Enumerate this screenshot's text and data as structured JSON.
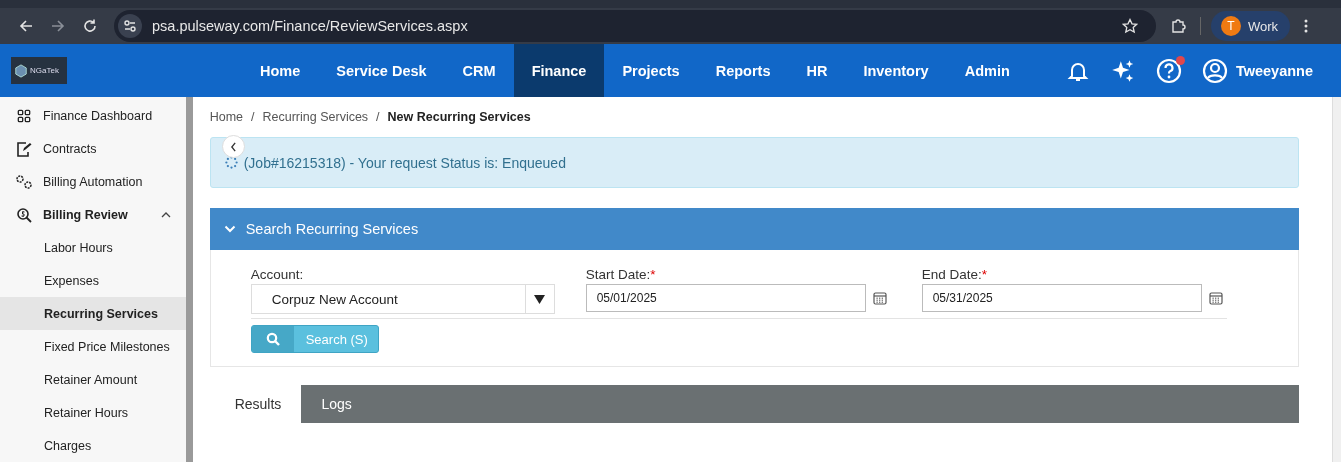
{
  "browser": {
    "url": "psa.pulseway.com/Finance/ReviewServices.aspx",
    "profile_initial": "T",
    "profile_name": "Work"
  },
  "logo": {
    "text": "NGaTek"
  },
  "nav": [
    {
      "label": "Home",
      "selected": false
    },
    {
      "label": "Service Desk",
      "selected": false
    },
    {
      "label": "CRM",
      "selected": false
    },
    {
      "label": "Finance",
      "selected": true
    },
    {
      "label": "Projects",
      "selected": false
    },
    {
      "label": "Reports",
      "selected": false
    },
    {
      "label": "HR",
      "selected": false
    },
    {
      "label": "Inventory",
      "selected": false
    },
    {
      "label": "Admin",
      "selected": false
    }
  ],
  "help_notification": true,
  "user": {
    "name": "Tweeyanne"
  },
  "sidebar": {
    "items": [
      {
        "label": "Finance Dashboard",
        "selected": false
      },
      {
        "label": "Contracts",
        "selected": false
      },
      {
        "label": "Billing Automation",
        "selected": false
      },
      {
        "label": "Billing Review",
        "expanded": true,
        "selected": false,
        "children": [
          {
            "label": "Labor Hours",
            "selected": false
          },
          {
            "label": "Expenses",
            "selected": false
          },
          {
            "label": "Recurring Services",
            "selected": true
          },
          {
            "label": "Fixed Price Milestones",
            "selected": false
          },
          {
            "label": "Retainer Amount",
            "selected": false
          },
          {
            "label": "Retainer Hours",
            "selected": false
          },
          {
            "label": "Charges",
            "selected": false
          }
        ]
      }
    ]
  },
  "breadcrumb": [
    {
      "label": "Home",
      "current": false
    },
    {
      "label": "Recurring Services",
      "current": false
    },
    {
      "label": "New Recurring Services",
      "current": true
    }
  ],
  "breadcrumb_separator": "/",
  "alert": {
    "text": "(Job#16215318) - Your request Status is: Enqueued"
  },
  "panel": {
    "title": "Search Recurring Services",
    "expanded": true,
    "fields": [
      {
        "kind": "select",
        "label": "Account:",
        "required": false,
        "value": "Corpuz New Account"
      },
      {
        "kind": "date",
        "label": "Start Date:",
        "required": true,
        "value": "05/01/2025"
      },
      {
        "kind": "date",
        "label": "End Date:",
        "required": true,
        "value": "05/31/2025"
      }
    ],
    "required_mark": "*",
    "search_button": "Search (S)"
  },
  "tabs": [
    {
      "label": "Results",
      "selected": true
    },
    {
      "label": "Logs",
      "selected": false
    }
  ]
}
